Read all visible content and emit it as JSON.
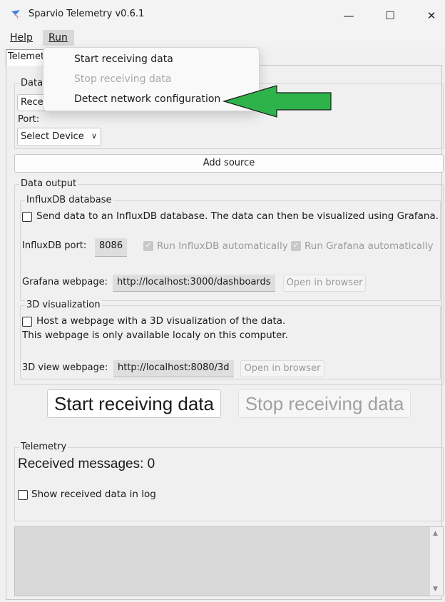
{
  "window": {
    "title": "Sparvio Telemetry v0.6.1",
    "min_glyph": "—",
    "max_glyph": "☐",
    "close_glyph": "✕"
  },
  "menubar": {
    "help": "Help",
    "run": "Run"
  },
  "run_menu": {
    "items": [
      {
        "label": "Start receiving data",
        "enabled": true
      },
      {
        "label": "Stop receiving data",
        "enabled": false
      },
      {
        "label": "Detect network configuration",
        "enabled": true
      }
    ]
  },
  "annotation": {
    "arrow_color": "#2db34a"
  },
  "tab": {
    "label": "Telemetry"
  },
  "data_source": {
    "group_label_visible": "Data",
    "receiver_select_visible": "Rece",
    "port_label": "Port:",
    "port_select": "Select Device",
    "add_source": "Add source"
  },
  "data_output": {
    "label": "Data output",
    "influx": {
      "label": "InfluxDB database",
      "send_checkbox": "Send data to an InfluxDB database. The data can then be visualized using Grafana.",
      "port_label": "InfluxDB port:",
      "port_value": "8086",
      "run_influx": "Run InfluxDB automatically",
      "run_grafana": "Run Grafana automatically",
      "grafana_label": "Grafana webpage:",
      "grafana_url": "http://localhost:3000/dashboards",
      "open_browser": "Open in browser"
    },
    "viz3d": {
      "label": "3D visualization",
      "host_checkbox": "Host a webpage with a 3D visualization of the data.",
      "note": "This webpage is only available localy on this computer.",
      "view_label": "3D view webpage:",
      "view_url": "http://localhost:8080/3d",
      "open_browser": "Open in browser"
    }
  },
  "controls": {
    "start": "Start receiving data",
    "stop": "Stop receiving data"
  },
  "telemetry": {
    "label": "Telemetry",
    "received": "Received messages: 0",
    "show_log": "Show received data in log"
  }
}
